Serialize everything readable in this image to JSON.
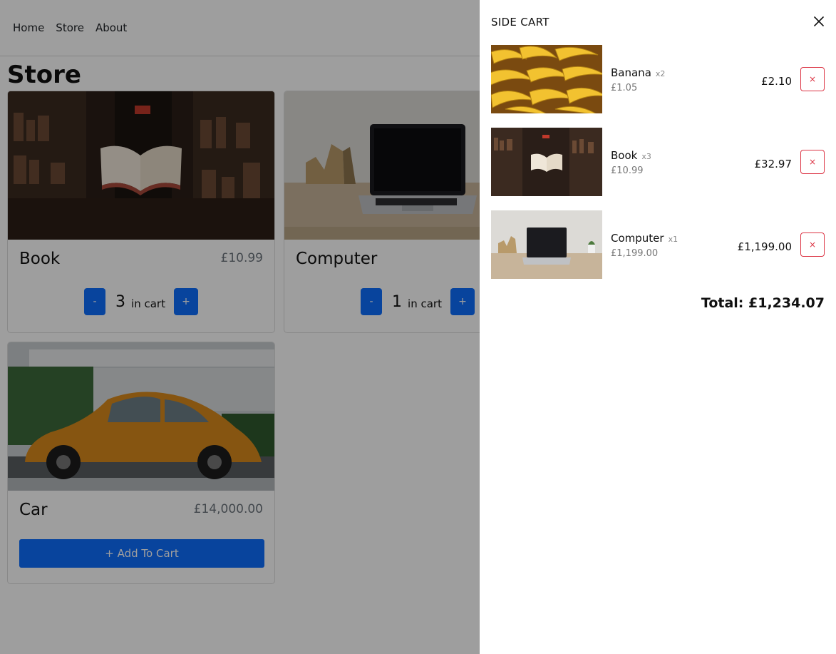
{
  "nav": {
    "links": [
      "Home",
      "Store",
      "About"
    ]
  },
  "store": {
    "title": "Store",
    "products": [
      {
        "name": "Book",
        "price": "£10.99",
        "quantity": "3",
        "in_cart_label": "in cart",
        "minus": "-",
        "plus": "+"
      },
      {
        "name": "Computer",
        "price": "",
        "quantity": "1",
        "in_cart_label": "in cart",
        "minus": "-",
        "plus": "+"
      },
      {
        "name": "Car",
        "price": "£14,000.00",
        "add_label": "+ Add To Cart"
      }
    ]
  },
  "cart": {
    "title": "SIDE CART",
    "items": [
      {
        "name": "Banana",
        "qty": "x2",
        "unit_price": "£1.05",
        "line_total": "£2.10",
        "remove": "×"
      },
      {
        "name": "Book",
        "qty": "x3",
        "unit_price": "£10.99",
        "line_total": "£32.97",
        "remove": "×"
      },
      {
        "name": "Computer",
        "qty": "x1",
        "unit_price": "£1,199.00",
        "line_total": "£1,199.00",
        "remove": "×"
      }
    ],
    "total": "Total: £1,234.07"
  },
  "colors": {
    "primary": "#0d6efd",
    "danger": "#dc3545",
    "overlay": "rgba(0,0,0,0.38)"
  }
}
